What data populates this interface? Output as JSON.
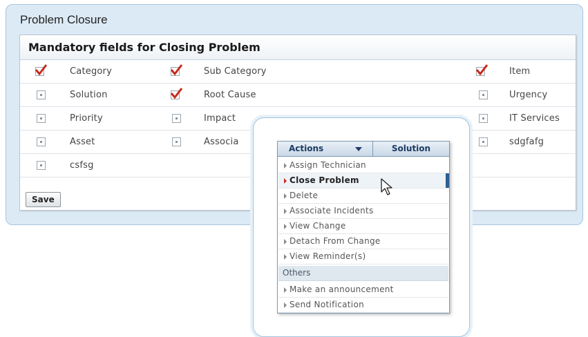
{
  "panel": {
    "title": "Problem Closure"
  },
  "form": {
    "header": "Mandatory fields for Closing Problem",
    "rows": [
      [
        {
          "label": "Category",
          "checked": true
        },
        {
          "label": "Sub Category",
          "checked": true
        },
        {
          "label": "Item",
          "checked": true
        }
      ],
      [
        {
          "label": "Solution",
          "checked": false
        },
        {
          "label": "Root Cause",
          "checked": true
        },
        {
          "label": "Urgency",
          "checked": false
        }
      ],
      [
        {
          "label": "Priority",
          "checked": false
        },
        {
          "label": "Impact",
          "checked": false
        },
        {
          "label": "IT Services",
          "checked": false
        }
      ],
      [
        {
          "label": "Asset",
          "checked": false
        },
        {
          "label": "Associa",
          "checked": false
        },
        {
          "label": "sdgfafg",
          "checked": false
        }
      ],
      [
        {
          "label": "csfsg",
          "checked": false
        }
      ]
    ],
    "save_label": "Save"
  },
  "menu": {
    "actions_label": "Actions",
    "solution_label": "Solution",
    "items": [
      "Assign Technician",
      "Close Problem",
      "Delete",
      "Associate Incidents",
      "View Change",
      "Detach From Change",
      "View Reminder(s)"
    ],
    "active_item": "Close Problem",
    "others_label": "Others",
    "other_items": [
      "Make an announcement",
      "Send Notification"
    ]
  },
  "colors": {
    "check": "#c62a1c",
    "panel_bg": "#dceaf5",
    "menu_header": "#1d3b63"
  }
}
